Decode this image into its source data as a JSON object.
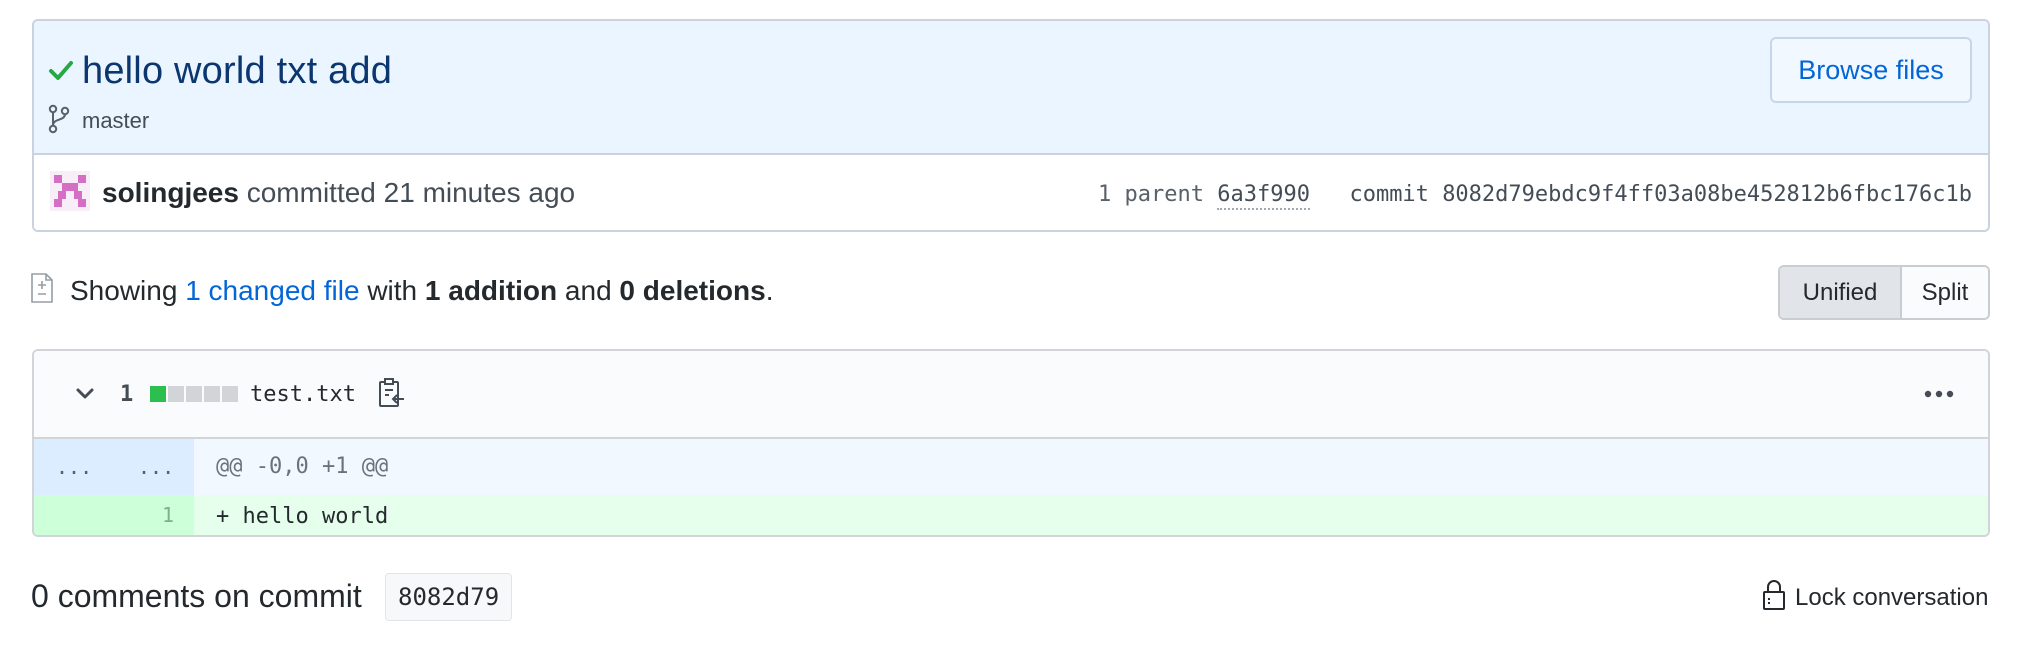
{
  "commit": {
    "title": "hello world txt add",
    "branch": "master",
    "browse_label": "Browse files",
    "author": "solingjees",
    "action_text": "committed 21 minutes ago",
    "parent_prefix": "1 parent",
    "parent_sha": "6a3f990",
    "commit_prefix": "commit",
    "commit_sha": "8082d79ebdc9f4ff03a08be452812b6fbc176c1b"
  },
  "summary": {
    "showing": "Showing",
    "changed_files": "1 changed file",
    "with": "with",
    "additions": "1 addition",
    "and": "and",
    "deletions": "0 deletions",
    "period": "."
  },
  "view_toggle": {
    "unified": "Unified",
    "split": "Split",
    "selected": "Unified"
  },
  "file": {
    "change_count": "1",
    "name": "test.txt",
    "hunk_left": "...",
    "hunk_right": "...",
    "hunk_header": "@@ -0,0 +1 @@",
    "lines": [
      {
        "new_num": "1",
        "text": "+ hello world"
      }
    ]
  },
  "comments": {
    "title": "0 comments on commit",
    "sha": "8082d79",
    "lock_label": "Lock conversation"
  },
  "colors": {
    "accent": "#0366d6",
    "success": "#28a745",
    "addition": "#2cbe4e",
    "header_bg": "#eaf5ff"
  }
}
